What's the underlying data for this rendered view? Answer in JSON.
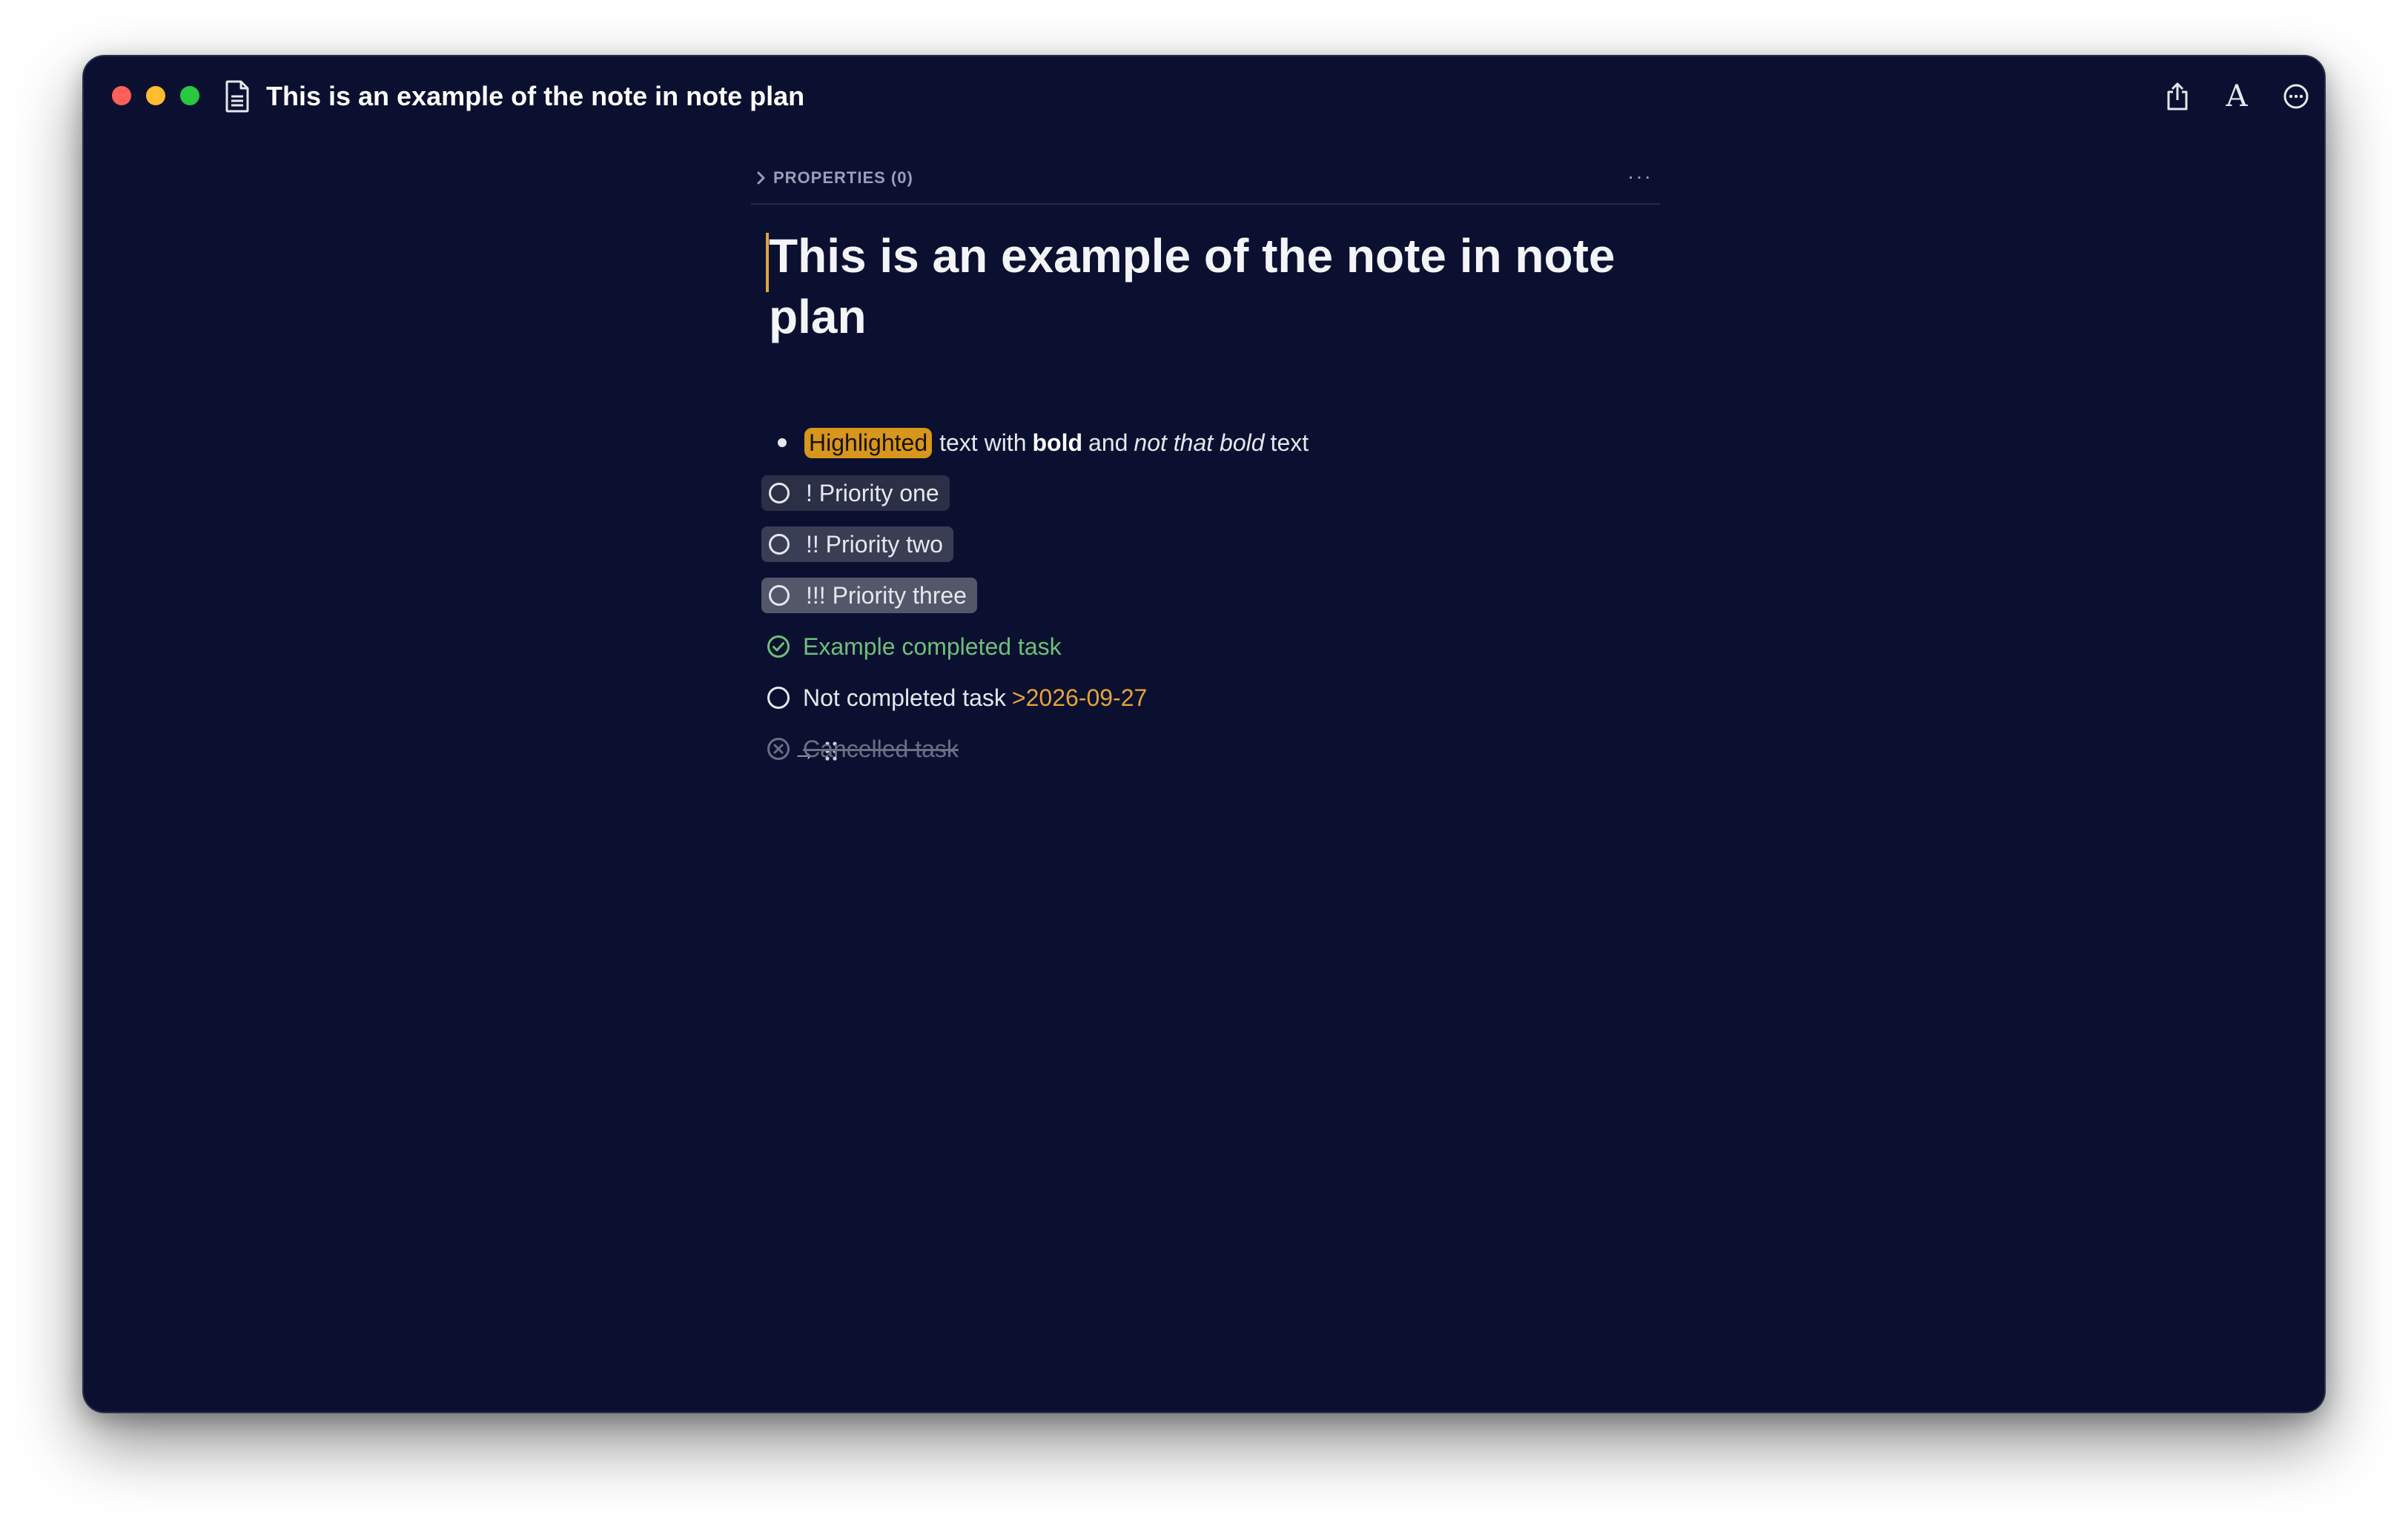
{
  "window": {
    "title": "This is an example of the note in note plan"
  },
  "toolbar": {
    "share_icon": "share-icon",
    "font_icon": "font-icon",
    "font_glyph": "A",
    "more_icon": "more-options-icon"
  },
  "properties": {
    "label": "PROPERTIES (0)",
    "more": "···"
  },
  "note": {
    "title": "This is an example of the note in note plan",
    "bullet": {
      "highlight": "Highlighted",
      "text1": "text with",
      "bold": "bold",
      "text2": "and",
      "italic": "not that bold",
      "text3": "text"
    },
    "tasks": [
      {
        "label": "! Priority one",
        "state": "open",
        "priority": 1
      },
      {
        "label": "!! Priority two",
        "state": "open",
        "priority": 2
      },
      {
        "label": "!!! Priority three",
        "state": "open",
        "priority": 3
      },
      {
        "label": "Example completed task",
        "state": "done"
      },
      {
        "label": "Not completed task",
        "date": ">2026-09-27",
        "state": "open"
      },
      {
        "label": "Cancelled task",
        "state": "cancelled"
      }
    ],
    "row_arrow": "→"
  },
  "colors": {
    "background": "#0b1030",
    "highlight": "#d7961c",
    "done": "#6cc07a",
    "date": "#e5a33b",
    "cancelled": "#6b6f85"
  }
}
